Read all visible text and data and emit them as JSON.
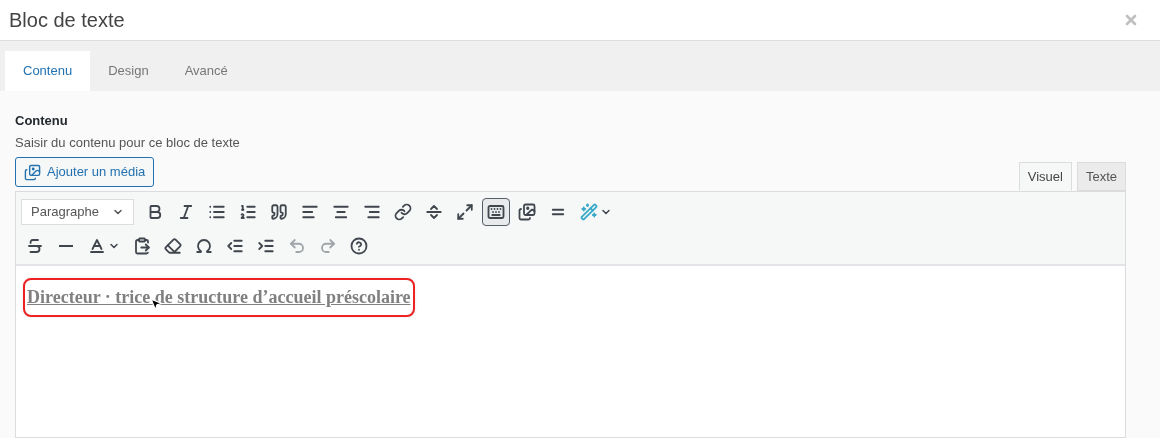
{
  "window": {
    "title": "Bloc de texte"
  },
  "tabs": [
    {
      "label": "Contenu",
      "selected": true
    },
    {
      "label": "Design",
      "selected": false
    },
    {
      "label": "Avancé",
      "selected": false
    }
  ],
  "field": {
    "label": "Contenu",
    "description": "Saisir du contenu pour ce bloc de texte",
    "media_button": "Ajouter un média"
  },
  "editor_tabs": [
    {
      "label": "Visuel",
      "selected": true
    },
    {
      "label": "Texte",
      "selected": false
    }
  ],
  "format_select": {
    "value": "Paragraphe"
  },
  "toolbar_rows": [
    [
      {
        "kind": "bold",
        "selected": false
      },
      {
        "kind": "italic",
        "selected": false
      },
      {
        "kind": "bullets",
        "selected": false
      },
      {
        "kind": "numbers",
        "selected": false
      },
      {
        "kind": "quote",
        "selected": false
      },
      {
        "kind": "left",
        "selected": false
      },
      {
        "kind": "center",
        "selected": false
      },
      {
        "kind": "right",
        "selected": false
      },
      {
        "kind": "link",
        "selected": false
      },
      {
        "kind": "more",
        "selected": false
      },
      {
        "kind": "fullscreen",
        "selected": false
      },
      {
        "kind": "toolbar",
        "selected": true
      },
      {
        "kind": "images",
        "selected": false
      },
      {
        "kind": "hr2",
        "selected": false
      },
      {
        "kind": "wand",
        "selected": false
      }
    ],
    [
      {
        "kind": "strike",
        "selected": false
      },
      {
        "kind": "hr",
        "selected": false
      },
      {
        "kind": "color",
        "selected": false
      },
      {
        "kind": "paste",
        "selected": false
      },
      {
        "kind": "eraser",
        "selected": false
      },
      {
        "kind": "omega",
        "selected": false
      },
      {
        "kind": "outdent",
        "selected": false
      },
      {
        "kind": "indent",
        "selected": false
      },
      {
        "kind": "undo",
        "selected": false
      },
      {
        "kind": "redo",
        "selected": false
      },
      {
        "kind": "help",
        "selected": false
      }
    ]
  ],
  "content": {
    "text": "Directeur · trice de structure d’accueil préscolaire",
    "highlighted": true
  }
}
